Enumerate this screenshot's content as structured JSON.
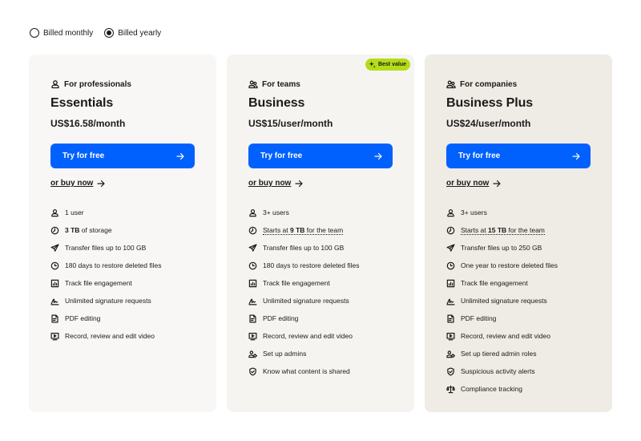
{
  "billing": {
    "monthly_label": "Billed monthly",
    "yearly_label": "Billed yearly",
    "selected": "yearly"
  },
  "colors": {
    "primary_button": "#0061fe",
    "badge": "#b4dc19",
    "card1_bg": "#f8f7f5",
    "card2_bg": "#f6f4f1",
    "card3_bg": "#efebe5"
  },
  "plans": [
    {
      "audience": "For professionals",
      "audience_icon": "user-icon",
      "name": "Essentials",
      "price": "US$16.58/month",
      "cta": "Try for free",
      "buy_link": "or buy now",
      "features": [
        {
          "icon": "user-icon",
          "pre": "",
          "bold": "",
          "text": "1 user"
        },
        {
          "icon": "clock-storage-icon",
          "pre": "",
          "bold": "3 TB",
          "text": " of storage"
        },
        {
          "icon": "paper-plane-icon",
          "pre": "",
          "bold": "",
          "text": "Transfer files up to 100 GB"
        },
        {
          "icon": "restore-icon",
          "pre": "",
          "bold": "",
          "text": "180 days to restore deleted files"
        },
        {
          "icon": "chart-icon",
          "pre": "",
          "bold": "",
          "text": "Track file engagement"
        },
        {
          "icon": "signature-icon",
          "pre": "",
          "bold": "",
          "text": "Unlimited signature requests"
        },
        {
          "icon": "pdf-edit-icon",
          "pre": "",
          "bold": "",
          "text": "PDF editing"
        },
        {
          "icon": "video-icon",
          "pre": "",
          "bold": "",
          "text": "Record, review and edit video"
        }
      ]
    },
    {
      "badge": "Best value",
      "audience": "For teams",
      "audience_icon": "team-icon",
      "name": "Business",
      "price": "US$15/user/month",
      "cta": "Try for free",
      "buy_link": "or buy now",
      "features": [
        {
          "icon": "user-icon",
          "pre": "",
          "bold": "",
          "text": "3+ users"
        },
        {
          "icon": "clock-storage-icon",
          "pre": "Starts at ",
          "bold": "9 TB",
          "text": " for the team",
          "dotted": true
        },
        {
          "icon": "paper-plane-icon",
          "pre": "",
          "bold": "",
          "text": "Transfer files up to 100 GB"
        },
        {
          "icon": "restore-icon",
          "pre": "",
          "bold": "",
          "text": "180 days to restore deleted files"
        },
        {
          "icon": "chart-icon",
          "pre": "",
          "bold": "",
          "text": "Track file engagement"
        },
        {
          "icon": "signature-icon",
          "pre": "",
          "bold": "",
          "text": "Unlimited signature requests"
        },
        {
          "icon": "pdf-edit-icon",
          "pre": "",
          "bold": "",
          "text": "PDF editing"
        },
        {
          "icon": "video-icon",
          "pre": "",
          "bold": "",
          "text": "Record, review and edit video"
        },
        {
          "icon": "admins-icon",
          "pre": "",
          "bold": "",
          "text": "Set up admins"
        },
        {
          "icon": "shield-icon",
          "pre": "",
          "bold": "",
          "text": "Know what content is shared"
        }
      ]
    },
    {
      "audience": "For companies",
      "audience_icon": "team-icon",
      "name": "Business Plus",
      "price": "US$24/user/month",
      "cta": "Try for free",
      "buy_link": "or buy now",
      "features": [
        {
          "icon": "user-icon",
          "pre": "",
          "bold": "",
          "text": "3+ users"
        },
        {
          "icon": "clock-storage-icon",
          "pre": "Starts at ",
          "bold": "15 TB",
          "text": " for the team",
          "dotted": true
        },
        {
          "icon": "paper-plane-icon",
          "pre": "",
          "bold": "",
          "text": "Transfer files up to 250 GB"
        },
        {
          "icon": "restore-icon",
          "pre": "",
          "bold": "",
          "text": "One year to restore deleted files"
        },
        {
          "icon": "chart-icon",
          "pre": "",
          "bold": "",
          "text": "Track file engagement"
        },
        {
          "icon": "signature-icon",
          "pre": "",
          "bold": "",
          "text": "Unlimited signature requests"
        },
        {
          "icon": "pdf-edit-icon",
          "pre": "",
          "bold": "",
          "text": "PDF editing"
        },
        {
          "icon": "video-icon",
          "pre": "",
          "bold": "",
          "text": "Record, review and edit video"
        },
        {
          "icon": "admins-icon",
          "pre": "",
          "bold": "",
          "text": "Set up tiered admin roles"
        },
        {
          "icon": "shield-icon",
          "pre": "",
          "bold": "",
          "text": "Suspicious activity alerts"
        },
        {
          "icon": "scales-icon",
          "pre": "",
          "bold": "",
          "text": "Compliance tracking"
        }
      ]
    }
  ]
}
